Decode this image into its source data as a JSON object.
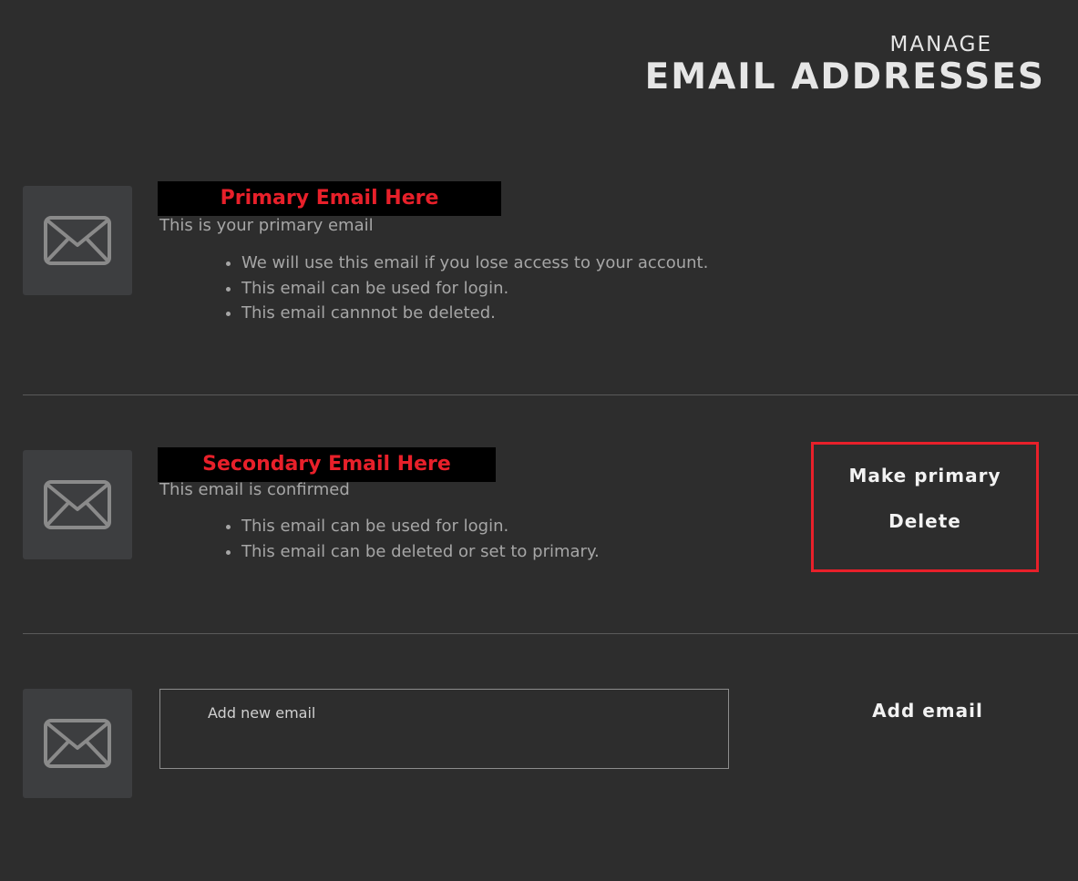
{
  "header": {
    "line1": "MANAGE",
    "line2": "EMAIL ADDRESSES"
  },
  "primary": {
    "email": "Primary Email Here",
    "status": "This is your primary email",
    "bullets": [
      "We will use this email if you lose access to your account.",
      "This email can be used for login.",
      "This email cannnot be deleted."
    ]
  },
  "secondary": {
    "email": "Secondary Email Here",
    "status": "This email is confirmed",
    "bullets": [
      "This email can be used for login.",
      "This email can be deleted or set to primary."
    ],
    "make_primary_label": "Make primary",
    "delete_label": "Delete"
  },
  "new_email": {
    "placeholder": "Add new email",
    "value": "",
    "add_label": "Add email"
  },
  "icons": {
    "mail": "envelope-icon"
  },
  "colors": {
    "background": "#2d2d2d",
    "accent": "#e8202a",
    "icon_box": "#3d3e40"
  }
}
